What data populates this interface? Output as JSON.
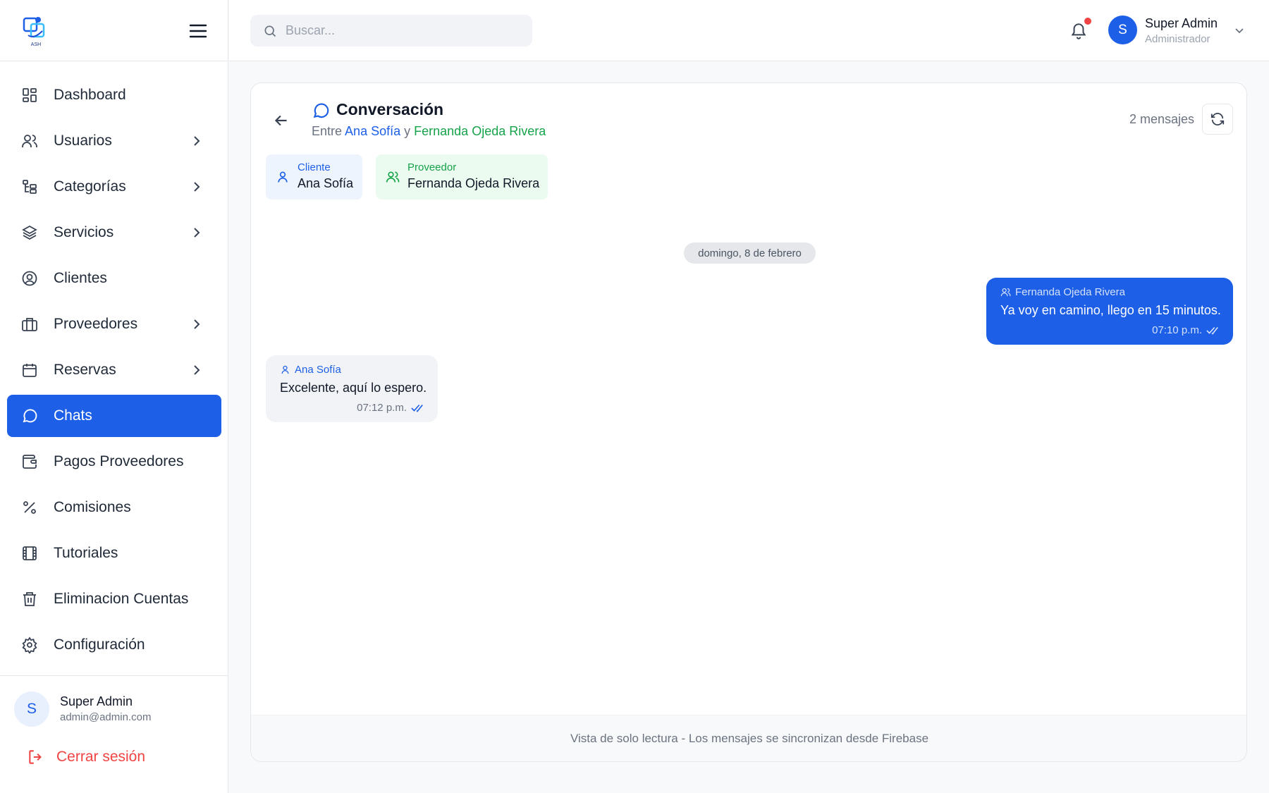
{
  "sidebar": {
    "logo_text": "ASH",
    "items": [
      {
        "label": "Dashboard",
        "icon": "grid-icon",
        "has_children": false
      },
      {
        "label": "Usuarios",
        "icon": "users-icon",
        "has_children": true
      },
      {
        "label": "Categorías",
        "icon": "folder-tree-icon",
        "has_children": true
      },
      {
        "label": "Servicios",
        "icon": "layers-icon",
        "has_children": true
      },
      {
        "label": "Clientes",
        "icon": "user-circle-icon",
        "has_children": false
      },
      {
        "label": "Proveedores",
        "icon": "briefcase-icon",
        "has_children": true
      },
      {
        "label": "Reservas",
        "icon": "calendar-icon",
        "has_children": true
      },
      {
        "label": "Chats",
        "icon": "message-circle-icon",
        "has_children": false,
        "active": true
      },
      {
        "label": "Pagos Proveedores",
        "icon": "wallet-icon",
        "has_children": false
      },
      {
        "label": "Comisiones",
        "icon": "percent-icon",
        "has_children": false
      },
      {
        "label": "Tutoriales",
        "icon": "film-icon",
        "has_children": false
      },
      {
        "label": "Eliminacion Cuentas",
        "icon": "trash-icon",
        "has_children": false
      },
      {
        "label": "Configuración",
        "icon": "settings-icon",
        "has_children": false
      }
    ],
    "footer": {
      "avatar_initial": "S",
      "name": "Super Admin",
      "email": "admin@admin.com",
      "logout_label": "Cerrar sesión"
    }
  },
  "topbar": {
    "search_placeholder": "Buscar...",
    "user": {
      "avatar_initial": "S",
      "name": "Super Admin",
      "role": "Administrador"
    }
  },
  "conversation": {
    "title": "Conversación",
    "subtitle_prefix": "Entre",
    "subtitle_joiner": "y",
    "client_name": "Ana Sofía",
    "provider_name": "Fernanda Ojeda Rivera",
    "message_count": "2 mensajes",
    "client_chip_label": "Cliente",
    "provider_chip_label": "Proveedor",
    "date_separator": "domingo, 8 de febrero",
    "messages": [
      {
        "sender": "Fernanda Ojeda Rivera",
        "text": "Ya voy en camino, llego en 15 minutos.",
        "time": "07:10 p.m.",
        "direction": "out"
      },
      {
        "sender": "Ana Sofía",
        "text": "Excelente, aquí lo espero.",
        "time": "07:12 p.m.",
        "direction": "in"
      }
    ],
    "footer_note": "Vista de solo lectura - Los mensajes se sincronizan desde Firebase"
  },
  "colors": {
    "accent": "#1d5fe6",
    "provider_green": "#16a34a",
    "danger": "#ef4444"
  }
}
